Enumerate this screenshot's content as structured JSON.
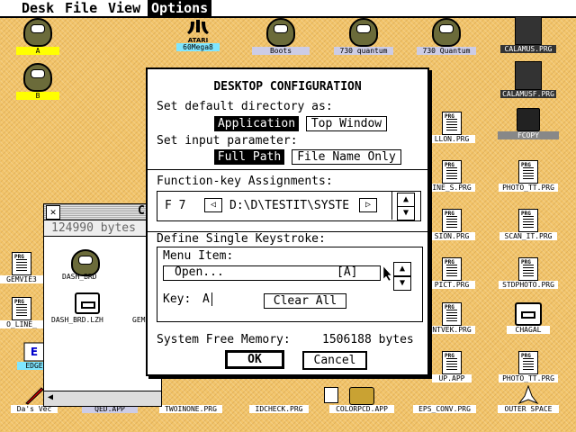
{
  "menubar": {
    "items": [
      {
        "label": "Desk"
      },
      {
        "label": "File"
      },
      {
        "label": "View"
      },
      {
        "label": "Options"
      }
    ]
  },
  "desktop_icons": {
    "drive_a": "A",
    "drive_b": "B",
    "atari": "60Mega8",
    "boots": "Boots",
    "quantum_730a": "730 quantum",
    "quantum_730b": "730 Quantum",
    "calamus": "CALAMUS.PRG",
    "calamusf": "CALAMUSF.PRG",
    "llon": "LLON.PRG",
    "fcopy": "FCOPY",
    "ine_s": "INE_S.PRG",
    "photo_tt": "PHOTO_TT.PRG",
    "sion": "SION.PRG",
    "scan_it": "SCAN_IT.PRG",
    "pict": "PICT.PRG",
    "stdphoto": "STDPHOTO.PRG",
    "ntvek": "NTVEK.PRG",
    "chagal": "CHAGAL",
    "up_app": "UP.APP",
    "photo_tt2": "PHOTO_TT.PRG",
    "gemview": "GEMVIE3",
    "oline": "O_LINE_",
    "edge": "EDGE",
    "das_vec": "Da's Vec",
    "qed": "QED.APP",
    "twoinone": "TWOINONE.PRG",
    "idcheck": "IDCHECK.PRG",
    "colorpcd": "COLORPCD.APP",
    "eps_conv": "EPS_CONV.PRG",
    "outer_space": "OUTER SPACE"
  },
  "window": {
    "title_char": "C",
    "free": "124990 bytes",
    "items": [
      {
        "label": "DASH_BRD"
      },
      {
        "label": "DASH_BRD.LZH"
      },
      {
        "label": "GEM"
      }
    ]
  },
  "dialog": {
    "title": "DESKTOP CONFIGURATION",
    "default_dir_label": "Set default directory as:",
    "application": "Application",
    "top_window": "Top Window",
    "input_param_label": "Set input parameter:",
    "full_path": "Full Path",
    "file_name_only": "File Name Only",
    "fkey_label": "Function-key Assignments:",
    "fkey_name": "F 7",
    "fkey_value": "D:\\D\\TESTIT\\SYSTE",
    "keystroke_label": "Define Single Keystroke:",
    "menu_item_label": "Menu Item:",
    "menu_item_value": "Open...",
    "menu_item_key": "[A]",
    "key_label": "Key:",
    "key_value": "A",
    "clear_all": "Clear All",
    "free_memory_label": "System Free Memory:",
    "free_memory_value": "1506188 bytes",
    "ok": "OK",
    "cancel": "Cancel"
  }
}
